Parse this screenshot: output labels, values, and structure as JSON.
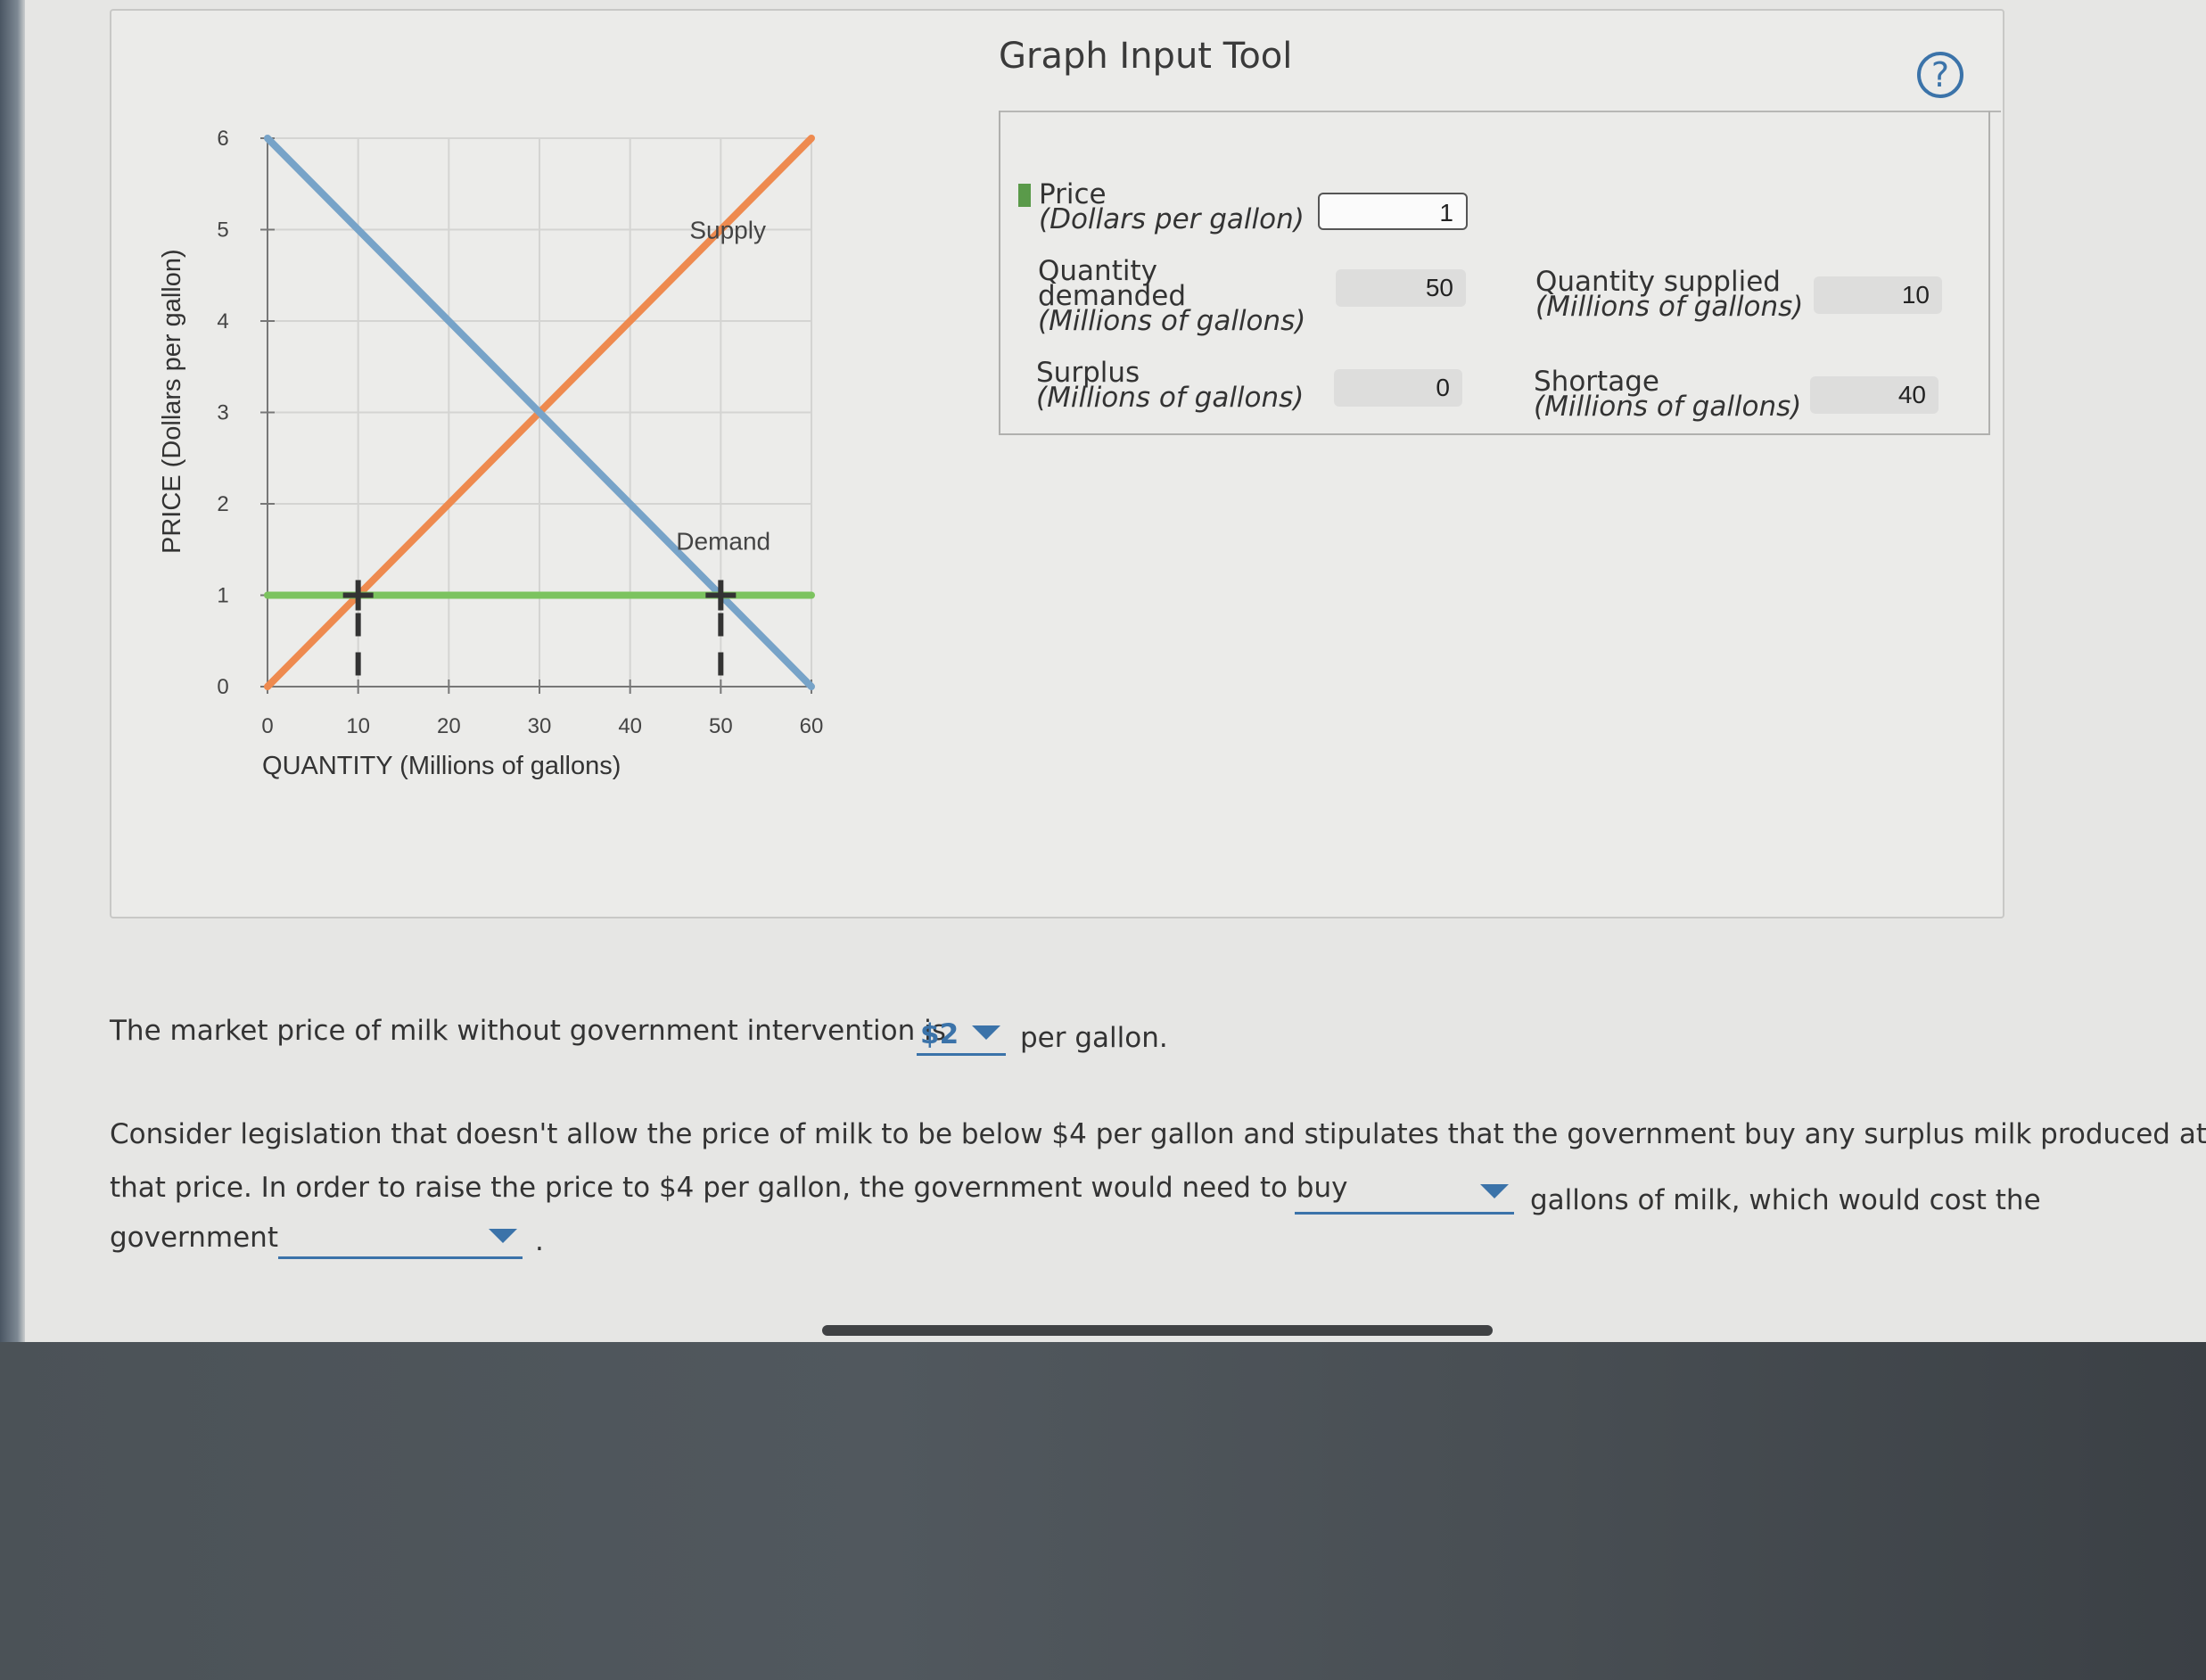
{
  "tool": {
    "title": "Graph Input Tool",
    "help_glyph": "?",
    "price_label": "Price",
    "price_units": "(Dollars per gallon)",
    "price_value": "1",
    "qd_label_1": "Quantity",
    "qd_label_2": "demanded",
    "qd_units": "(Millions of gallons)",
    "qd_value": "50",
    "qs_label": "Quantity supplied",
    "qs_units": "(Millions of gallons)",
    "qs_value": "10",
    "surplus_label": "Surplus",
    "surplus_units": "(Millions of gallons)",
    "surplus_value": "0",
    "shortage_label": "Shortage",
    "shortage_units": "(Millions of gallons)",
    "shortage_value": "40"
  },
  "chart_data": {
    "type": "line",
    "xlabel": "QUANTITY (Millions of gallons)",
    "ylabel": "PRICE (Dollars per gallon)",
    "xlim": [
      0,
      60
    ],
    "ylim": [
      0,
      6
    ],
    "xticks": [
      0,
      10,
      20,
      30,
      40,
      50,
      60
    ],
    "yticks": [
      0,
      1,
      2,
      3,
      4,
      5,
      6
    ],
    "grid": true,
    "series": [
      {
        "name": "Supply",
        "color": "#ee8a4f",
        "points": [
          [
            0,
            0
          ],
          [
            60,
            6
          ]
        ]
      },
      {
        "name": "Demand",
        "color": "#77a3c8",
        "points": [
          [
            0,
            6
          ],
          [
            60,
            0
          ]
        ]
      },
      {
        "name": "",
        "color": "#7cc35f",
        "points": [
          [
            0,
            1
          ],
          [
            60,
            1
          ]
        ]
      }
    ],
    "markers": [
      [
        10,
        1
      ],
      [
        50,
        1
      ]
    ],
    "marker_color": "#333333"
  },
  "question": {
    "line1_before": "The market price of milk without government intervention is",
    "line1_selected": "$2",
    "line1_after": "per gallon.",
    "line2": "Consider legislation that doesn't allow the price of milk to be below $4 per gallon and stipulates that the government buy any surplus milk produced at",
    "line3_before": "that price. In order to raise the price to $4 per gallon, the government would need to buy",
    "line3_after": "gallons of milk, which would cost the",
    "line4_before": "government",
    "line4_after": "."
  },
  "colors": {
    "accent": "#3b73a9"
  }
}
